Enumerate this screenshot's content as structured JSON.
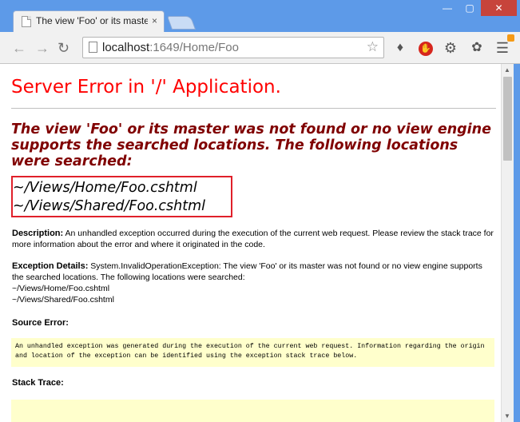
{
  "browser": {
    "tab_title": "The view 'Foo' or its maste",
    "tab_close": "×",
    "url_host": "localhost",
    "url_rest": ":1649/Home/Foo",
    "controls": {
      "minimize": "—",
      "maximize": "▢",
      "close": "✕"
    },
    "icons": [
      "back-icon",
      "forward-icon",
      "reload-icon",
      "star-icon",
      "extensions-icon",
      "adblock-icon",
      "gear-icon",
      "bug-icon",
      "menu-icon"
    ]
  },
  "page": {
    "heading": "Server Error in '/' Application.",
    "message": "The view 'Foo' or its master was not found or no view engine supports the searched locations. The following locations were searched:",
    "locations": [
      "~/Views/Home/Foo.cshtml",
      "~/Views/Shared/Foo.cshtml"
    ],
    "description_label": "Description:",
    "description_text": "An unhandled exception occurred during the execution of the current web request. Please review the stack trace for more information about the error and where it originated in the code.",
    "exception_label": "Exception Details:",
    "exception_text": "System.InvalidOperationException: The view 'Foo' or its master was not found or no view engine supports the searched locations. The following locations were searched:",
    "exception_locations": [
      "~/Views/Home/Foo.cshtml",
      "~/Views/Shared/Foo.cshtml"
    ],
    "source_error_label": "Source Error:",
    "source_error_code": "An unhandled exception was generated during the execution of the current web request. Information regarding the origin and location of the exception can be identified using the exception stack trace below.",
    "stack_trace_label": "Stack Trace:"
  },
  "colors": {
    "heading": "#ff0000",
    "message": "#800000",
    "highlight_box": "#e0202a",
    "code_bg": "#ffffcc"
  }
}
